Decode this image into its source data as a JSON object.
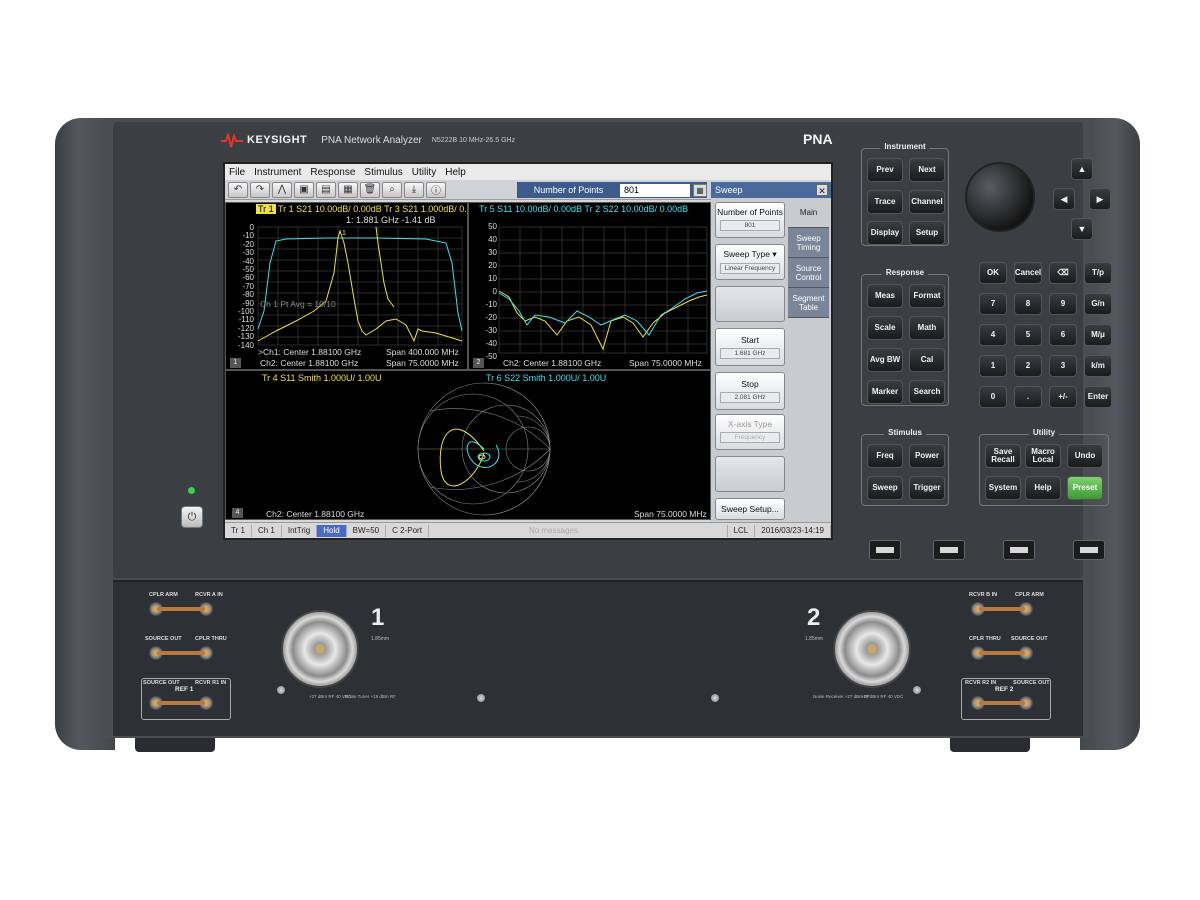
{
  "header": {
    "brand": "KEYSIGHT",
    "model": "PNA Network Analyzer",
    "model_no": "N5222B  10 MHz-26.5 GHz",
    "series": "PNA"
  },
  "menu": [
    "File",
    "Instrument",
    "Response",
    "Stimulus",
    "Utility",
    "Help"
  ],
  "toolbar": {
    "icons": [
      "undo-icon",
      "redo-icon",
      "marker-icon",
      "autoscale-icon",
      "memory-icon",
      "save-icon",
      "delete-icon",
      "zoom-icon",
      "download-icon",
      "info-icon"
    ],
    "number_of_points_label": "Number of Points",
    "number_of_points_value": "801"
  },
  "windows": {
    "w1": {
      "traces_top": "Tr 1  S21 10.00dB/ 0.00dB   Tr 3  S21 1.000dB/ 0.00dB",
      "marker": "1:   1.881 GHz    -1.41 dB",
      "y_ticks": [
        "0",
        "-10",
        "-20",
        "-30",
        "-40",
        "-50",
        "-60",
        "-70",
        "-80",
        "-90",
        "-100",
        "-110",
        "-120",
        "-130",
        "-140"
      ],
      "avg": "Ch 1 Pt Avg = 10/10",
      "footer1_left": ">Ch1: Center   1.88100 GHz",
      "footer1_right": "Span  400.000 MHz",
      "footer2_left": "Ch2: Center   1.88100 GHz",
      "footer2_right": "Span  75.0000 MHz",
      "num": "1"
    },
    "w2": {
      "traces_top": "Tr 5  S11 10.00dB/ 0.00dB   Tr 2  S22 10.00dB/ 0.00dB",
      "y_ticks": [
        "50",
        "40",
        "30",
        "20",
        "10",
        "0",
        "-10",
        "-20",
        "-30",
        "-40",
        "-50"
      ],
      "footer_left": "Ch2: Center   1.88100 GHz",
      "footer_right": "Span  75.0000 MHz",
      "num": "2"
    },
    "w4": {
      "trace_a": "Tr 4  S11 Smith 1.000U/  1.00U",
      "trace_b": "Tr 6  S22 Smith 1.000U/  1.00U",
      "footer_left": "Ch2: Center   1.88100 GHz",
      "footer_right": "Span  75.0000 MHz",
      "num": "4"
    }
  },
  "sweep_panel": {
    "title": "Sweep",
    "softkeys": [
      {
        "label": "Number of Points",
        "value": "801"
      },
      {
        "label": "Sweep Type",
        "value": "Linear Frequency"
      },
      {
        "label": "",
        "value": ""
      },
      {
        "label": "Start",
        "value": "1.681 GHz"
      },
      {
        "label": "Stop",
        "value": "2.081 GHz"
      },
      {
        "label": "X-axis Type",
        "value": "Frequency"
      },
      {
        "label": "",
        "value": ""
      },
      {
        "label": "Sweep Setup...",
        "value": ""
      }
    ],
    "tabs": [
      "Main",
      "Sweep Timing",
      "Source Control",
      "Segment Table"
    ]
  },
  "status": {
    "items": [
      "Tr 1",
      "Ch 1",
      "IntTrig",
      "Hold",
      "BW=50",
      "C  2-Port"
    ],
    "message": "No messages",
    "lcl": "LCL",
    "datetime": "2016/03/23-14:19"
  },
  "hardkeys": {
    "instrument_title": "Instrument",
    "instrument": [
      "Prev",
      "Next",
      "Trace",
      "Channel",
      "Display",
      "Setup"
    ],
    "response_title": "Response",
    "response": [
      "Meas",
      "Format",
      "Scale",
      "Math",
      "Avg BW",
      "Cal",
      "Marker",
      "Search"
    ],
    "stimulus_title": "Stimulus",
    "stimulus": [
      "Freq",
      "Power",
      "Sweep",
      "Trigger"
    ],
    "utility_title": "Utility",
    "utility": [
      "Save Recall",
      "Macro Local",
      "Undo",
      "System",
      "Help",
      "Preset"
    ],
    "keypad": [
      "OK",
      "Cancel",
      "⌫",
      "T/p",
      "7",
      "8",
      "9",
      "G/n",
      "4",
      "5",
      "6",
      "M/μ",
      "1",
      "2",
      "3",
      "k/m",
      "0",
      ".",
      "+/-",
      "Enter"
    ]
  },
  "ports": {
    "p1": "1",
    "p2": "2",
    "p_sub": "1.85mm",
    "p1_note_a": "+27 dBm RF 40 VDC",
    "p1_note_b": "Noise Tuner +19 dBm RF",
    "p2_note_a": "Noise Receiver +27 dBm RF",
    "p2_note_b": "+27 dBm RF 40 VDC",
    "left_labels": [
      "CPLR ARM",
      "RCVR A IN",
      "SOURCE OUT",
      "CPLR THRU",
      "SOURCE OUT",
      "RCVR R1 IN"
    ],
    "left_ref": "REF 1",
    "right_labels": [
      "RCVR B IN",
      "CPLR ARM",
      "CPLR THRU",
      "SOURCE OUT",
      "RCVR R2 IN",
      "SOURCE OUT"
    ],
    "right_ref": "REF 2"
  },
  "colors": {
    "trace_yellow": "#f0e040",
    "trace_cyan": "#40e0f0",
    "preset_green": "#4caf3d"
  }
}
